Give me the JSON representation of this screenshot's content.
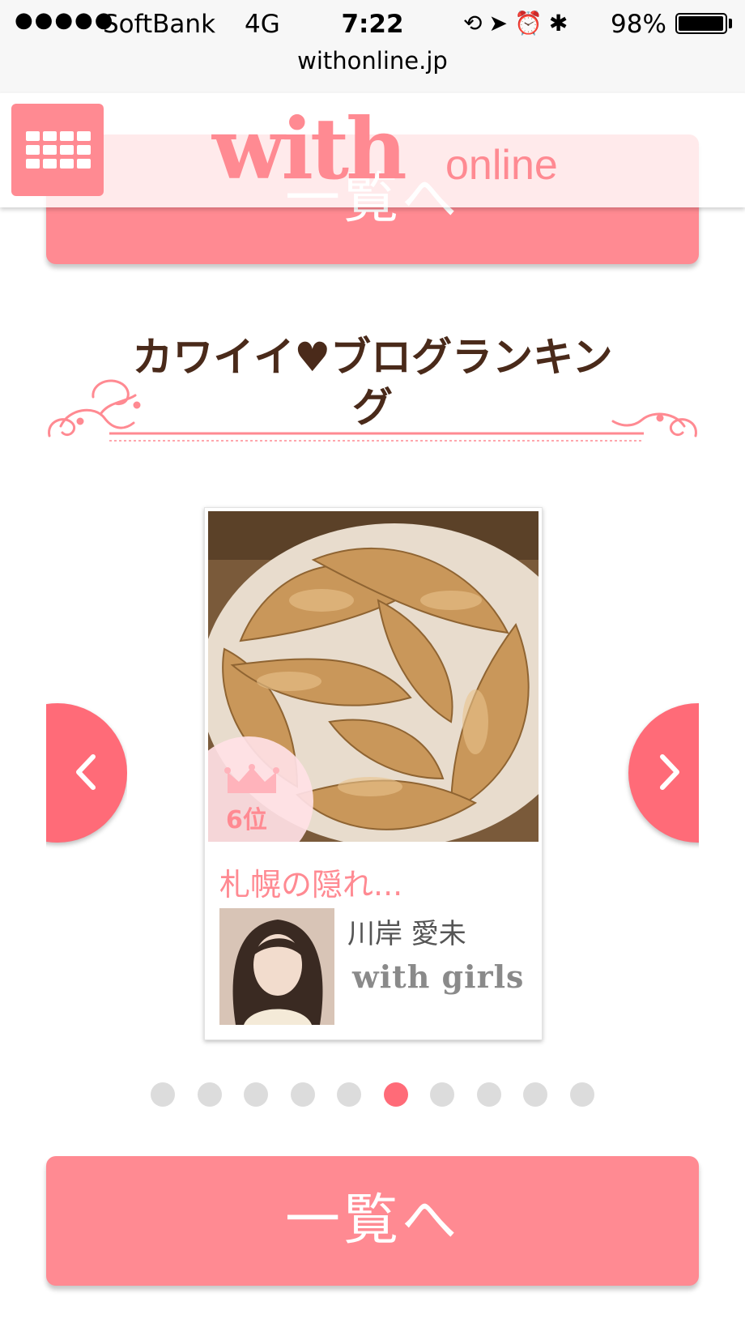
{
  "status_bar": {
    "signal": "●●●●●",
    "carrier": "SoftBank",
    "network": "4G",
    "time": "7:22",
    "icons": [
      "rotation-lock-icon",
      "location-arrow-icon",
      "alarm-icon",
      "bluetooth-icon"
    ],
    "battery_pct": "98%",
    "battery_level": 0.98
  },
  "browser": {
    "url": "withonline.jp"
  },
  "header": {
    "logo_main": "with",
    "logo_sub": "online",
    "menu_icon": "grid-menu-icon"
  },
  "top_list_button": {
    "label": "一覧へ"
  },
  "section": {
    "title": "カワイイ♥ブログランキング"
  },
  "carousel": {
    "card": {
      "rank": "6位",
      "title": "札幌の隠れ...",
      "author": "川岸 愛未",
      "brand": "with girls"
    },
    "prev_icon": "chevron-left-icon",
    "next_icon": "chevron-right-icon",
    "page_count": 10,
    "active_index": 5
  },
  "bottom_list_button": {
    "label": "一覧へ"
  },
  "colors": {
    "accent": "#ff8a92",
    "arrow": "#ff6b78",
    "heading": "#4a2a1a",
    "dot_inactive": "#dcdcdc"
  }
}
